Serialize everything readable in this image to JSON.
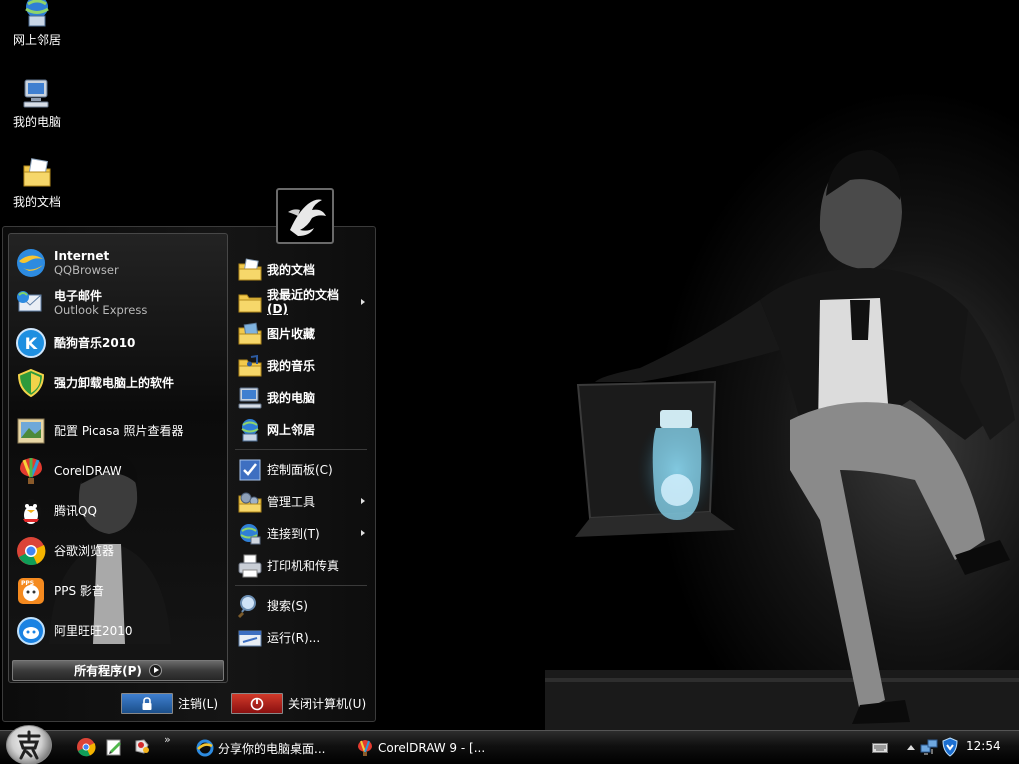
{
  "desktop": {
    "icons": [
      {
        "label": "网上邻居",
        "icon": "network-places-icon"
      },
      {
        "label": "我的电脑",
        "icon": "my-computer-icon"
      },
      {
        "label": "我的文档",
        "icon": "my-documents-icon"
      }
    ]
  },
  "start_menu": {
    "pinned": [
      {
        "title": "Internet",
        "subtitle": "QQBrowser",
        "icon": "qqbrowser-icon"
      },
      {
        "title": "电子邮件",
        "subtitle": "Outlook Express",
        "icon": "outlook-express-icon"
      }
    ],
    "recent": [
      {
        "title": "酷狗音乐2010",
        "icon": "kugou-music-icon",
        "bold": true
      },
      {
        "title": "强力卸载电脑上的软件",
        "icon": "uninstaller-shield-icon",
        "bold": true
      },
      {
        "title": "配置 Picasa 照片查看器",
        "icon": "picasa-icon",
        "bold": false
      },
      {
        "title": "CorelDRAW",
        "icon": "coreldraw-icon",
        "bold": false
      },
      {
        "title": "腾讯QQ",
        "icon": "qq-penguin-icon",
        "bold": false
      },
      {
        "title": "谷歌浏览器",
        "icon": "chrome-icon",
        "bold": false
      },
      {
        "title": "PPS 影音",
        "icon": "pps-icon",
        "bold": false
      },
      {
        "title": "阿里旺旺2010",
        "icon": "aliwangwang-icon",
        "bold": false
      }
    ],
    "all_programs": "所有程序(P)",
    "places": [
      {
        "label": "我的文档",
        "icon": "my-documents-icon",
        "bold": true,
        "submenu": false
      },
      {
        "label": "我最近的文档",
        "label2": "(D)",
        "icon": "recent-documents-icon",
        "bold": true,
        "submenu": true
      },
      {
        "label": "图片收藏",
        "icon": "my-pictures-icon",
        "bold": true,
        "submenu": false
      },
      {
        "label": "我的音乐",
        "icon": "my-music-icon",
        "bold": true,
        "submenu": false
      },
      {
        "label": "我的电脑",
        "icon": "my-computer-icon",
        "bold": true,
        "submenu": false
      },
      {
        "label": "网上邻居",
        "icon": "network-places-icon",
        "bold": true,
        "submenu": false
      },
      {
        "label": "控制面板(C)",
        "icon": "control-panel-icon",
        "bold": false,
        "submenu": false
      },
      {
        "label": "管理工具",
        "icon": "admin-tools-icon",
        "bold": false,
        "submenu": true
      },
      {
        "label": "连接到(T)",
        "icon": "connect-to-icon",
        "bold": false,
        "submenu": true
      },
      {
        "label": "打印机和传真",
        "icon": "printer-icon",
        "bold": false,
        "submenu": false
      },
      {
        "label": "搜索(S)",
        "icon": "search-icon",
        "bold": false,
        "submenu": false
      },
      {
        "label": "运行(R)...",
        "icon": "run-icon",
        "bold": false,
        "submenu": false
      }
    ],
    "logoff": "注销(L)",
    "shutdown": "关闭计算机(U)"
  },
  "taskbar": {
    "quick_launch": [
      "chrome-icon",
      "edit-icon",
      "game-icon"
    ],
    "more": "»",
    "tasks": [
      {
        "label": "分享你的电脑桌面...",
        "icon": "ie-icon"
      },
      {
        "label": "CorelDRAW 9 - [...",
        "icon": "coreldraw-icon"
      }
    ],
    "clock": "12:54"
  },
  "colors": {
    "menu_bg": "#111111",
    "logoff_blue": "#1b4f8a",
    "shutdown_red": "#8a1010"
  }
}
